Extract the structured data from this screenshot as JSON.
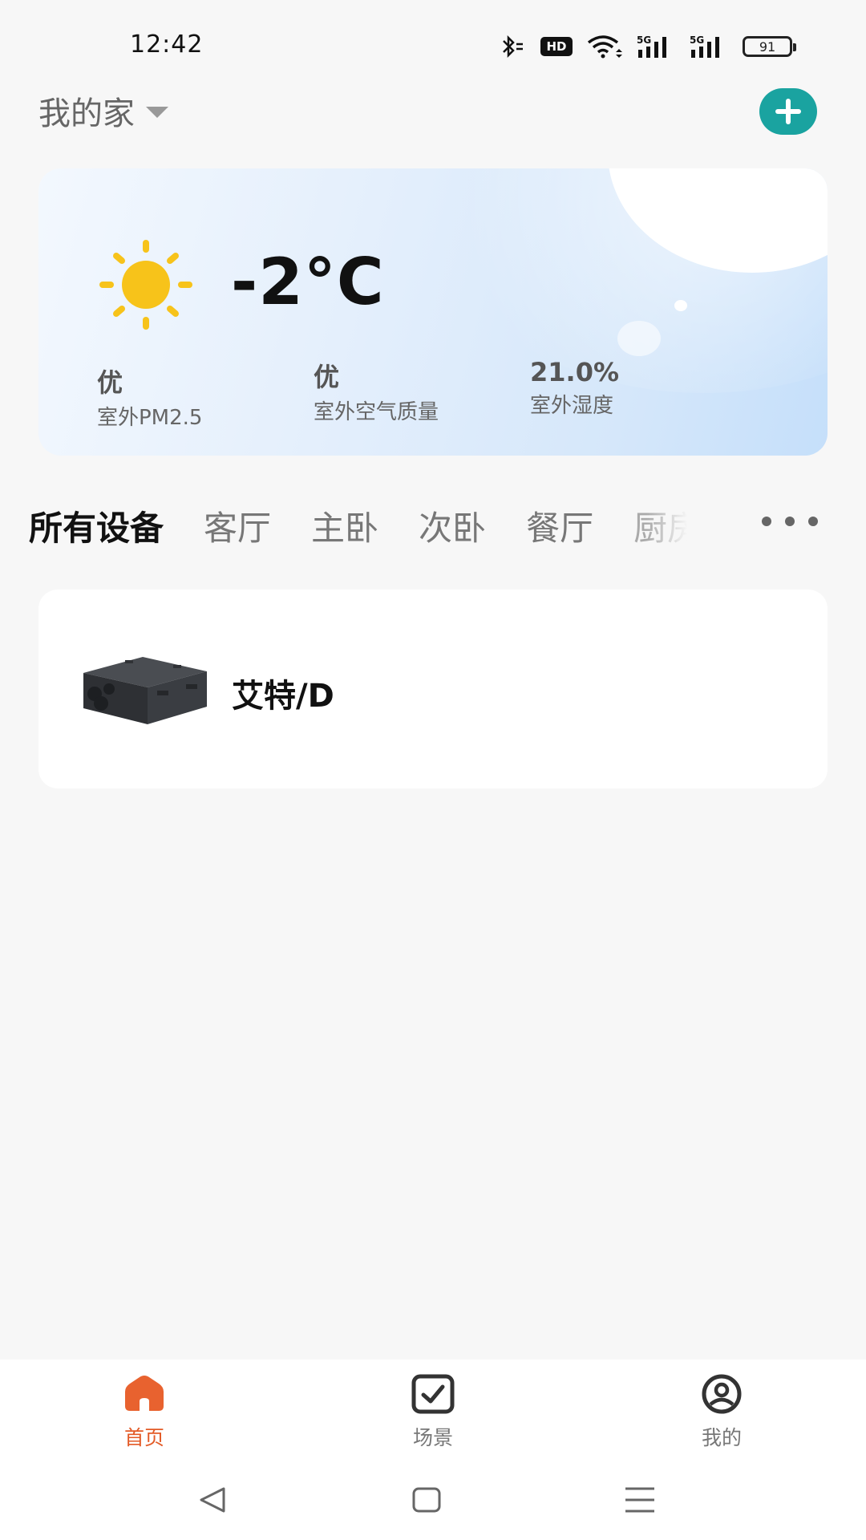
{
  "status_bar": {
    "time": "12:42",
    "hd_label": "HD",
    "battery_level": "91",
    "icons": [
      "bluetooth-icon",
      "hd-icon",
      "wifi-icon",
      "5g-signal-icon",
      "5g-signal-icon",
      "battery-icon"
    ]
  },
  "header": {
    "home_name": "我的家",
    "add_icon": "plus-icon"
  },
  "weather": {
    "icon": "sun-icon",
    "temperature": "-2°C",
    "metrics": [
      {
        "value": "优",
        "label": "室外PM2.5"
      },
      {
        "value": "优",
        "label": "室外空气质量"
      },
      {
        "value": "21.0%",
        "label": "室外湿度"
      }
    ]
  },
  "room_tabs": {
    "items": [
      "所有设备",
      "客厅",
      "主卧",
      "次卧",
      "餐厅",
      "厨房"
    ],
    "active_index": 0,
    "more_icon": "more-dots-icon"
  },
  "devices": [
    {
      "name": "艾特/D",
      "image": "ventilation-unit-image"
    }
  ],
  "bottom_nav": {
    "items": [
      {
        "label": "首页",
        "icon": "home-icon",
        "active": true
      },
      {
        "label": "场景",
        "icon": "scene-checkbox-icon",
        "active": false
      },
      {
        "label": "我的",
        "icon": "profile-icon",
        "active": false
      }
    ]
  },
  "colors": {
    "accent_teal": "#1aa3a0",
    "active_orange": "#e35a26",
    "background": "#f7f7f7"
  }
}
